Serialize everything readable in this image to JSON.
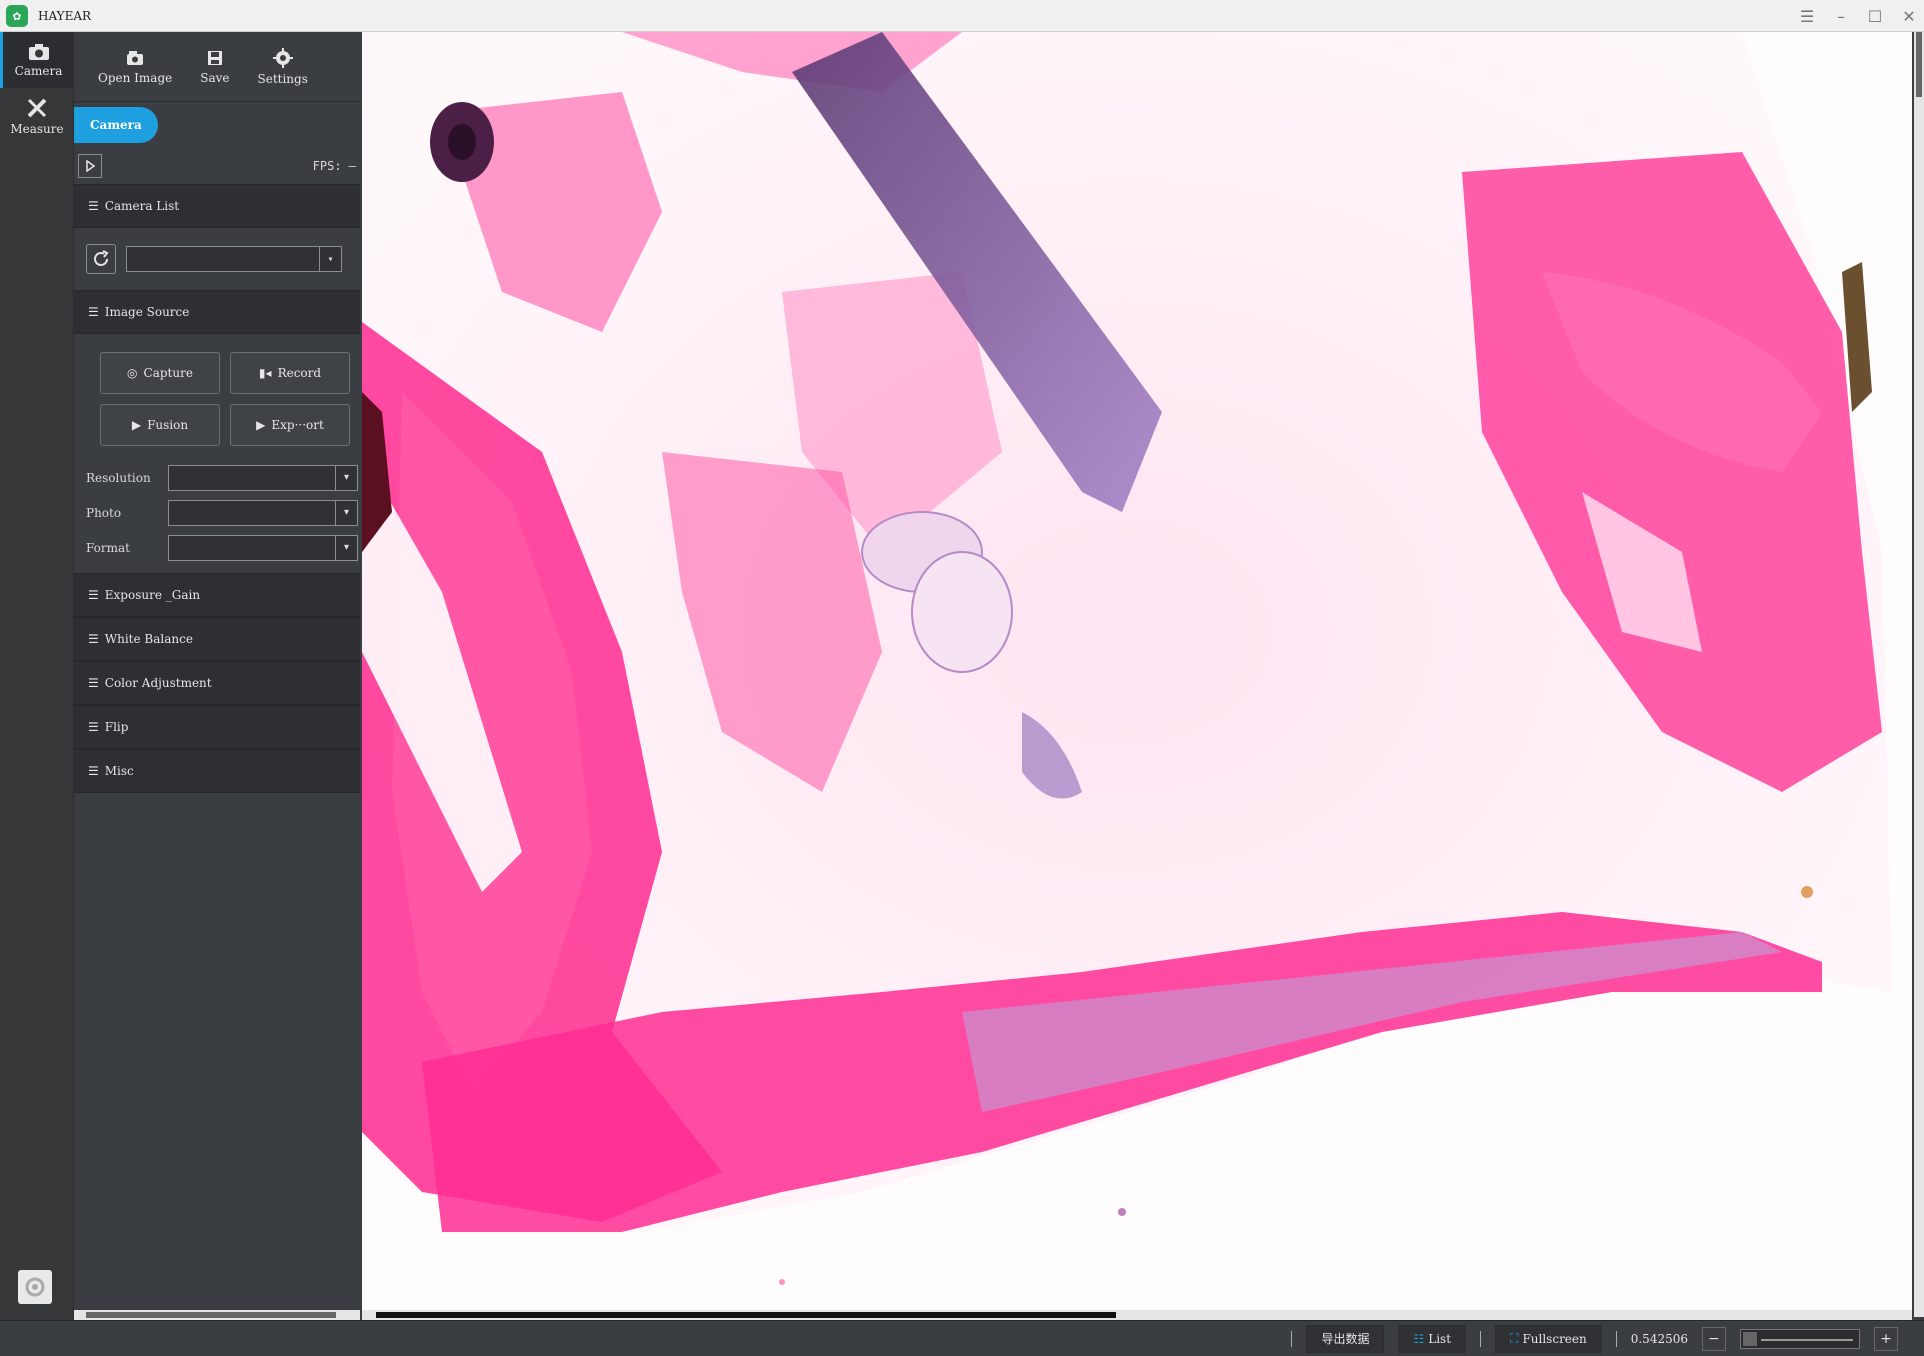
{
  "window": {
    "title": "HAYEAR"
  },
  "rail": {
    "items": [
      {
        "label": "Camera",
        "active": true
      },
      {
        "label": "Measure",
        "active": false
      }
    ]
  },
  "toolbar": {
    "open_image": "Open Image",
    "save": "Save",
    "settings": "Settings"
  },
  "panel": {
    "tab_label": "Camera",
    "fps_label": "FPS: —",
    "sections": {
      "camera_list": "Camera List",
      "image_source": "Image Source",
      "exposure_gain": "Exposure _Gain",
      "white_balance": "White Balance",
      "color_adjustment": "Color Adjustment",
      "flip": "Flip",
      "misc": "Misc"
    },
    "buttons": {
      "capture": "Capture",
      "record": "Record",
      "fusion": "Fusion",
      "export": "Exp···ort"
    },
    "form": {
      "resolution": "Resolution",
      "photo": "Photo",
      "format": "Format"
    }
  },
  "statusbar": {
    "export_data": "导出数据",
    "list": "List",
    "fullscreen": "Fullscreen",
    "zoom_value": "0.542506",
    "zoom_minus": "−",
    "zoom_plus": "+"
  },
  "colors": {
    "accent": "#1ea0e0",
    "panel": "#3a3d42",
    "stain_pink": "#ff2a8f",
    "stain_purple": "#7a3a8e"
  }
}
